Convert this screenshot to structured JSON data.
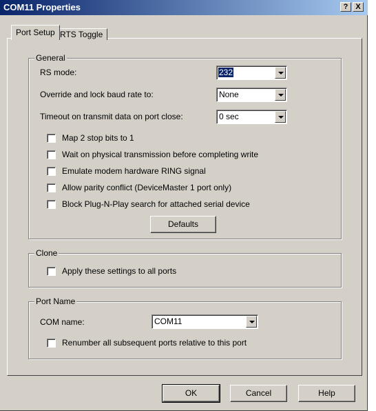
{
  "window": {
    "title": "COM11 Properties",
    "help_button": "?",
    "close_button": "X"
  },
  "tabs": [
    {
      "label": "Port Setup",
      "active": true
    },
    {
      "label": "RTS Toggle",
      "active": false
    }
  ],
  "general": {
    "legend": "General",
    "rs_mode": {
      "label": "RS mode:",
      "value": "232"
    },
    "baud": {
      "label": "Override and lock baud rate to:",
      "value": "None"
    },
    "timeout": {
      "label": "Timeout on transmit data on port close:",
      "value": "0 sec"
    },
    "checkboxes": [
      {
        "label": "Map 2 stop bits to 1",
        "checked": false
      },
      {
        "label": "Wait on physical transmission before completing write",
        "checked": false
      },
      {
        "label": "Emulate modem hardware RING signal",
        "checked": false
      },
      {
        "label": "Allow parity conflict (DeviceMaster 1 port only)",
        "checked": false
      },
      {
        "label": "Block Plug-N-Play search for attached serial device",
        "checked": false
      }
    ],
    "defaults_button": "Defaults"
  },
  "clone": {
    "legend": "Clone",
    "apply_all": {
      "label": "Apply these settings to all ports",
      "checked": false
    }
  },
  "port_name": {
    "legend": "Port Name",
    "com_name": {
      "label": "COM name:",
      "value": "COM11"
    },
    "renumber": {
      "label": "Renumber all subsequent ports relative to this port",
      "checked": false
    }
  },
  "buttons": {
    "ok": "OK",
    "cancel": "Cancel",
    "help": "Help"
  }
}
